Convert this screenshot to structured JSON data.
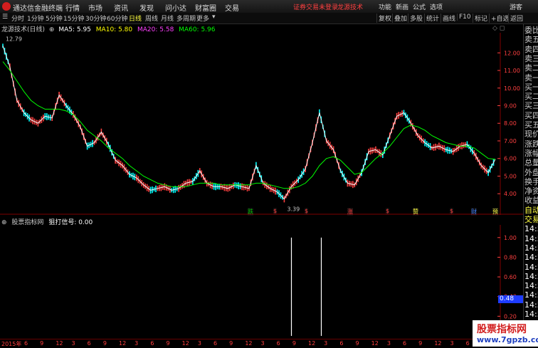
{
  "menubar": {
    "app_title": "通达信金融终端",
    "menus": [
      "行情",
      "市场",
      "资讯",
      "发现",
      "问小达",
      "财富圈",
      "交易"
    ],
    "notice": "证券交易未登录",
    "company": "龙源技术",
    "sys_menus": [
      "功能",
      "新画",
      "公式",
      "选项"
    ],
    "user": "游客"
  },
  "toolbar": {
    "periods": [
      "分时",
      "1分钟",
      "5分钟",
      "15分钟",
      "30分钟",
      "60分钟",
      "日线",
      "周线",
      "月线",
      "多周期",
      "更多"
    ],
    "active_period": "日线",
    "right_buttons": [
      "复权",
      "叠加",
      "多股",
      "统计",
      "画线",
      "F10",
      "标记",
      "+自选",
      "返回"
    ]
  },
  "legend": {
    "stock": "龙源技术(日线)",
    "ma5": "MA5: 5.95",
    "ma10": "MA10: 5.80",
    "ma20": "MA20: 5.58",
    "ma60": "MA60: 5.96",
    "colors": {
      "ma5": "#ffffff",
      "ma10": "#ffff00",
      "ma20": "#ff40ff",
      "ma60": "#00ff00"
    }
  },
  "price_annotations": {
    "high": "12.79",
    "low": "3.39"
  },
  "events": [
    {
      "label": "跌",
      "color": "#00c000"
    },
    {
      "label": "$",
      "color": "#ff4040"
    },
    {
      "label": "$",
      "color": "#ff4040"
    },
    {
      "label": "涨",
      "color": "#ff4040"
    },
    {
      "label": "$",
      "color": "#ff4040"
    },
    {
      "label": "赞",
      "color": "#ffff40"
    },
    {
      "label": "$",
      "color": "#ff4040"
    },
    {
      "label": "财",
      "color": "#4080ff"
    },
    {
      "label": "预",
      "color": "#ffff40"
    }
  ],
  "indicator": {
    "name": "股票指标网",
    "signal": "狙打信号: 0.00",
    "readout": "0.48"
  },
  "sidebar": {
    "items": [
      "委比",
      "卖五",
      "卖四",
      "卖三",
      "卖二",
      "卖一",
      "买一",
      "买二",
      "买三",
      "买四",
      "买五",
      "现价",
      "涨跌",
      "涨幅",
      "总量",
      "外盘",
      "换手",
      "净资",
      "收益",
      "自动",
      "交易",
      "14:5",
      "14:5",
      "14:5",
      "14:5",
      "14:5",
      "14:5",
      "14:5",
      "14:5",
      "14:5",
      "14:5"
    ]
  },
  "x_axis": {
    "year": "2015年",
    "labels": [
      "6",
      "9",
      "12",
      "3",
      "6",
      "9",
      "12",
      "3",
      "6",
      "9",
      "12",
      "3",
      "6",
      "9",
      "12",
      "3",
      "6",
      "9",
      "12",
      "3",
      "6",
      "9",
      "12",
      "3",
      "6",
      "9",
      "12",
      "3",
      "6",
      "9"
    ]
  },
  "watermark": {
    "line1": "股票指标网",
    "line2": "www.7gpzb.com"
  },
  "chart_data": [
    {
      "type": "candlestick-line",
      "title": "龙源技术(日线)",
      "y_ticks": [
        12.0,
        11.0,
        10.0,
        9.0,
        8.0,
        7.0,
        6.0,
        5.0,
        4.0
      ],
      "ylim": [
        3.2,
        12.9
      ],
      "x": [
        0,
        1,
        2,
        3,
        4,
        5,
        6,
        7,
        8,
        9,
        10,
        11,
        12,
        13,
        14,
        15,
        16,
        17,
        18,
        19,
        20,
        21,
        22,
        23,
        24,
        25,
        26,
        27,
        28,
        29,
        30,
        31,
        32,
        33,
        34,
        35,
        36,
        37,
        38,
        39,
        40,
        41,
        42,
        43,
        44,
        45,
        46,
        47,
        48,
        49,
        50,
        51,
        52,
        53,
        54,
        55,
        56,
        57,
        58,
        59,
        60,
        61,
        62,
        63,
        64,
        65,
        66,
        67,
        68,
        69,
        70
      ],
      "close": [
        12.4,
        11.2,
        9.3,
        8.6,
        8.2,
        8.0,
        8.4,
        8.3,
        9.6,
        9.0,
        8.5,
        7.8,
        6.7,
        6.9,
        7.5,
        6.8,
        5.9,
        5.6,
        5.1,
        4.9,
        4.5,
        4.2,
        4.3,
        4.4,
        4.2,
        4.3,
        4.6,
        4.7,
        5.3,
        4.6,
        4.4,
        4.4,
        4.3,
        4.5,
        4.4,
        4.3,
        5.6,
        4.6,
        4.3,
        4.1,
        3.7,
        4.4,
        4.8,
        5.4,
        6.9,
        8.6,
        7.0,
        6.5,
        5.3,
        4.6,
        4.5,
        5.2,
        6.4,
        6.5,
        6.2,
        7.3,
        8.4,
        8.6,
        8.0,
        7.3,
        6.9,
        6.6,
        6.7,
        6.5,
        6.4,
        6.7,
        6.8,
        6.3,
        5.6,
        5.2,
        5.96
      ],
      "ma60": [
        11.5,
        11.0,
        10.4,
        9.8,
        9.3,
        9.0,
        8.8,
        8.8,
        8.8,
        8.7,
        8.5,
        8.1,
        7.6,
        7.3,
        7.0,
        6.6,
        6.3,
        6.0,
        5.6,
        5.3,
        5.0,
        4.8,
        4.6,
        4.5,
        4.4,
        4.4,
        4.4,
        4.5,
        4.6,
        4.6,
        4.6,
        4.5,
        4.5,
        4.5,
        4.5,
        4.5,
        4.6,
        4.6,
        4.5,
        4.4,
        4.3,
        4.3,
        4.4,
        4.6,
        5.0,
        5.6,
        6.0,
        6.1,
        5.9,
        5.5,
        5.1,
        5.2,
        5.6,
        6.0,
        6.3,
        6.7,
        7.2,
        7.7,
        7.9,
        7.8,
        7.6,
        7.3,
        7.1,
        6.9,
        6.8,
        6.7,
        6.7,
        6.6,
        6.3,
        6.0,
        5.96
      ],
      "annotations": [
        {
          "x": 0,
          "y": 12.79,
          "text": "12.79"
        },
        {
          "x": 40,
          "y": 3.39,
          "text": "3.39"
        }
      ]
    },
    {
      "type": "bar",
      "title": "狙打信号",
      "y_ticks": [
        1.0,
        0.8,
        0.6,
        0.4,
        0.2
      ],
      "ylim": [
        0,
        1.1
      ],
      "signals": [
        {
          "x": 0.585,
          "value": 1.0
        },
        {
          "x": 0.645,
          "value": 1.0
        }
      ],
      "current": 0.0
    }
  ]
}
